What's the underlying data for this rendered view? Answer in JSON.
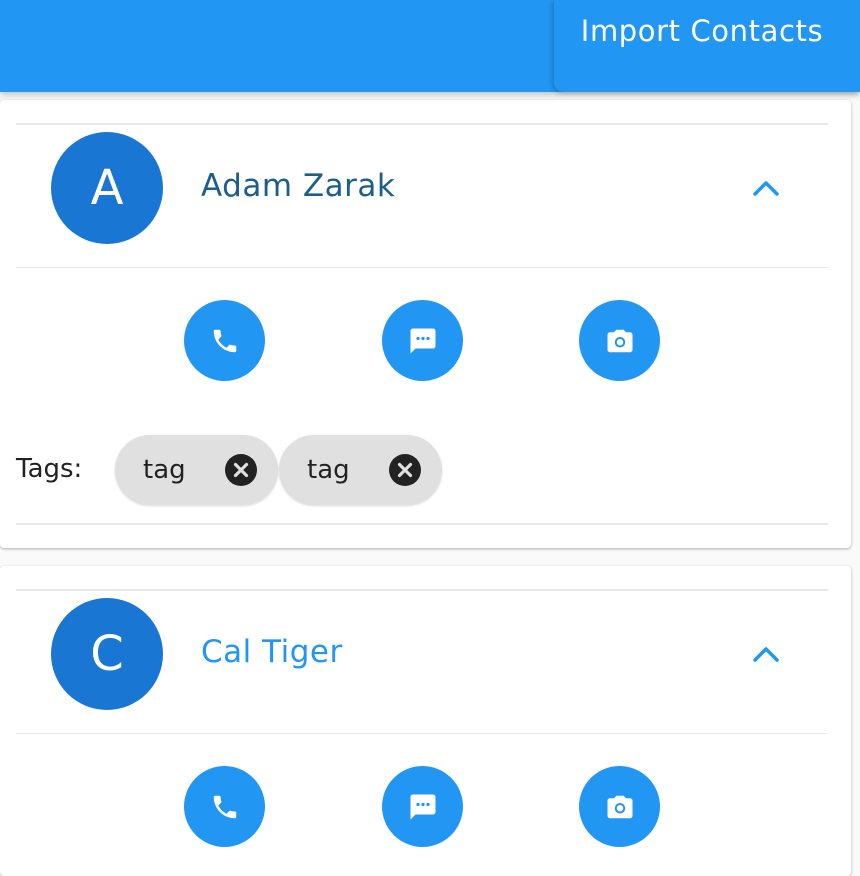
{
  "header": {
    "import_label": "Import Contacts",
    "color": "#2196f3"
  },
  "contacts": [
    {
      "initial": "A",
      "name": "Adam Zarak",
      "expanded": true,
      "actions": [
        "phone-icon",
        "message-icon",
        "camera-icon"
      ],
      "tags_label": "Tags:",
      "tags": [
        {
          "label": "tag"
        },
        {
          "label": "tag"
        }
      ]
    },
    {
      "initial": "C",
      "name": "Cal Tiger",
      "expanded": true,
      "actions": [
        "phone-icon",
        "message-icon",
        "camera-icon"
      ]
    }
  ],
  "colors": {
    "primary": "#2196f3",
    "avatar": "#1976d2",
    "chip": "#e0e0e0"
  }
}
